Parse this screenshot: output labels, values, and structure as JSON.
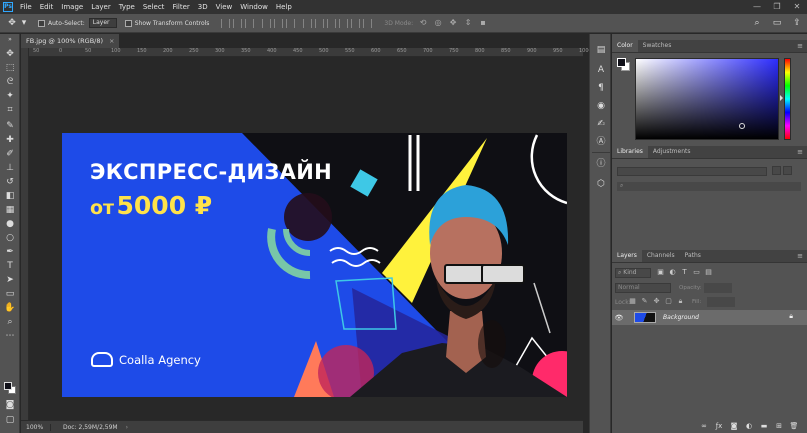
{
  "app": {
    "logo": "Ps"
  },
  "menu": [
    "File",
    "Edit",
    "Image",
    "Layer",
    "Type",
    "Select",
    "Filter",
    "3D",
    "View",
    "Window",
    "Help"
  ],
  "window_controls": [
    "—",
    "❐",
    "✕"
  ],
  "options_bar": {
    "auto_select_label": "Auto-Select:",
    "auto_select_value": "Layer",
    "transform_label": "Show Transform Controls",
    "mode_3d_label": "3D Mode:"
  },
  "document": {
    "tab_title": "FB.jpg @ 100% (RGB/8)",
    "tab_close": "×",
    "ruler_ticks": [
      "50",
      "0",
      "50",
      "100",
      "150",
      "200",
      "250",
      "300",
      "350",
      "400",
      "450",
      "500",
      "550",
      "600",
      "650",
      "700",
      "750",
      "800",
      "850",
      "900",
      "950",
      "1000"
    ],
    "canvas": {
      "headline": "ЭКСПРЕСС-ДИЗАЙН",
      "price_prefix": "от",
      "price_amount": "5000 ₽",
      "logo_text": "Coalla Agency",
      "colors": {
        "blue": "#1e4be8",
        "yellow": "#ffe24a",
        "cyan": "#3ec8e6",
        "pink": "#ff6b6b",
        "black": "#0f0f14"
      }
    },
    "status": {
      "zoom": "100%",
      "doc_info": "Doc: 2,59M/2,59M",
      "arrow": "›"
    }
  },
  "panels": {
    "color_tabs": [
      "Color",
      "Swatches"
    ],
    "library_tabs": [
      "Libraries",
      "Adjustments"
    ],
    "library_search_placeholder": "",
    "layers_tabs": [
      "Layers",
      "Channels",
      "Paths"
    ],
    "layers": {
      "kind_filter": "Kind",
      "blend_mode": "Normal",
      "opacity_label": "Opacity:",
      "lock_label": "Lock:",
      "fill_label": "Fill:",
      "items": [
        {
          "name": "Background",
          "visible": true,
          "locked": true
        }
      ]
    },
    "menu_icon": "≡"
  },
  "accent_color": "#31a8ff"
}
